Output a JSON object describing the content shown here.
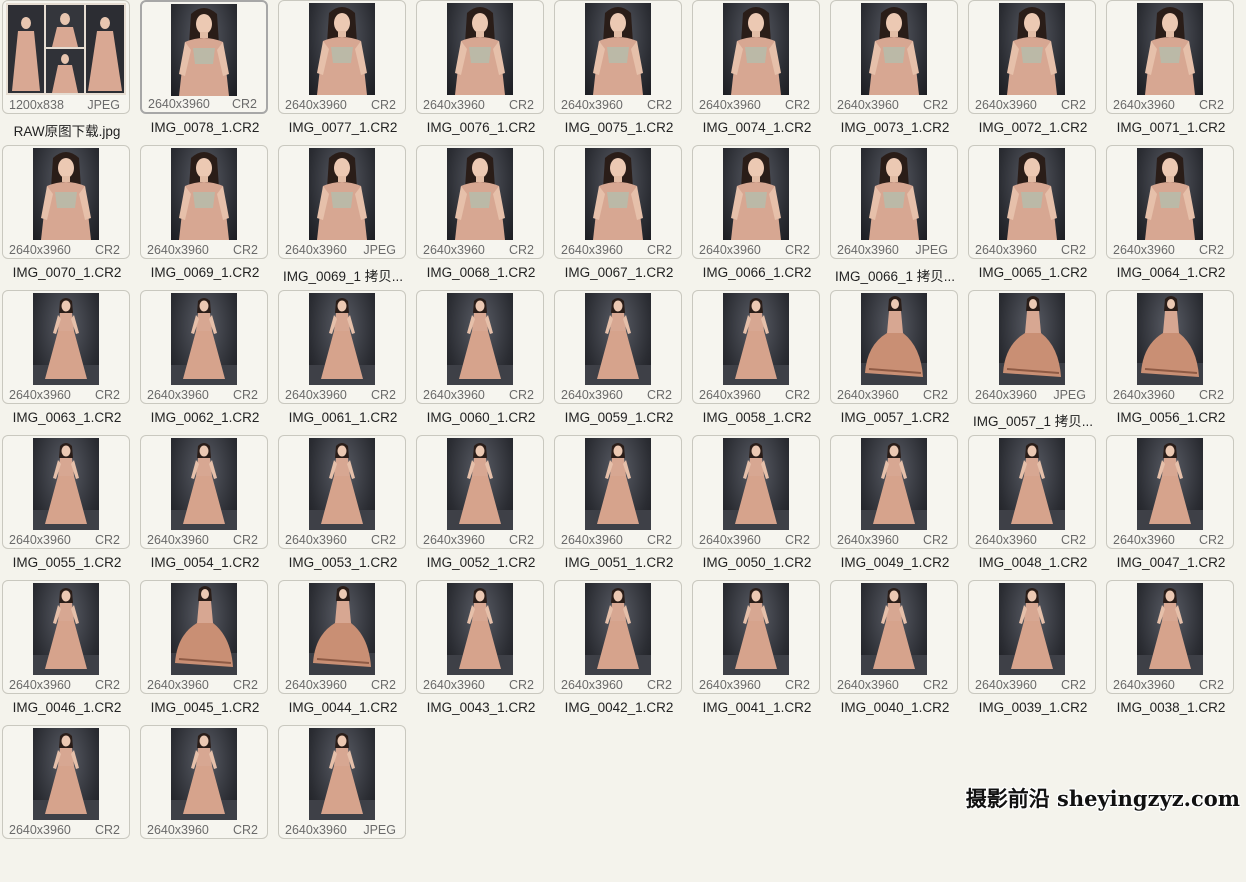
{
  "files": [
    {
      "name": "RAW原图下载.jpg",
      "dims": "1200x838",
      "type": "JPEG",
      "pose": "collage"
    },
    {
      "name": "IMG_0078_1.CR2",
      "dims": "2640x3960",
      "type": "CR2",
      "pose": "close",
      "selected": true
    },
    {
      "name": "IMG_0077_1.CR2",
      "dims": "2640x3960",
      "type": "CR2",
      "pose": "close"
    },
    {
      "name": "IMG_0076_1.CR2",
      "dims": "2640x3960",
      "type": "CR2",
      "pose": "close"
    },
    {
      "name": "IMG_0075_1.CR2",
      "dims": "2640x3960",
      "type": "CR2",
      "pose": "close"
    },
    {
      "name": "IMG_0074_1.CR2",
      "dims": "2640x3960",
      "type": "CR2",
      "pose": "close"
    },
    {
      "name": "IMG_0073_1.CR2",
      "dims": "2640x3960",
      "type": "CR2",
      "pose": "close"
    },
    {
      "name": "IMG_0072_1.CR2",
      "dims": "2640x3960",
      "type": "CR2",
      "pose": "close"
    },
    {
      "name": "IMG_0071_1.CR2",
      "dims": "2640x3960",
      "type": "CR2",
      "pose": "close"
    },
    {
      "name": "IMG_0070_1.CR2",
      "dims": "2640x3960",
      "type": "CR2",
      "pose": "close"
    },
    {
      "name": "IMG_0069_1.CR2",
      "dims": "2640x3960",
      "type": "CR2",
      "pose": "close"
    },
    {
      "name": "IMG_0069_1 拷贝...",
      "dims": "2640x3960",
      "type": "JPEG",
      "pose": "close"
    },
    {
      "name": "IMG_0068_1.CR2",
      "dims": "2640x3960",
      "type": "CR2",
      "pose": "close"
    },
    {
      "name": "IMG_0067_1.CR2",
      "dims": "2640x3960",
      "type": "CR2",
      "pose": "close"
    },
    {
      "name": "IMG_0066_1.CR2",
      "dims": "2640x3960",
      "type": "CR2",
      "pose": "close"
    },
    {
      "name": "IMG_0066_1 拷贝...",
      "dims": "2640x3960",
      "type": "JPEG",
      "pose": "close"
    },
    {
      "name": "IMG_0065_1.CR2",
      "dims": "2640x3960",
      "type": "CR2",
      "pose": "close"
    },
    {
      "name": "IMG_0064_1.CR2",
      "dims": "2640x3960",
      "type": "CR2",
      "pose": "close"
    },
    {
      "name": "IMG_0063_1.CR2",
      "dims": "2640x3960",
      "type": "CR2",
      "pose": "full"
    },
    {
      "name": "IMG_0062_1.CR2",
      "dims": "2640x3960",
      "type": "CR2",
      "pose": "full"
    },
    {
      "name": "IMG_0061_1.CR2",
      "dims": "2640x3960",
      "type": "CR2",
      "pose": "full"
    },
    {
      "name": "IMG_0060_1.CR2",
      "dims": "2640x3960",
      "type": "CR2",
      "pose": "full"
    },
    {
      "name": "IMG_0059_1.CR2",
      "dims": "2640x3960",
      "type": "CR2",
      "pose": "full"
    },
    {
      "name": "IMG_0058_1.CR2",
      "dims": "2640x3960",
      "type": "CR2",
      "pose": "full"
    },
    {
      "name": "IMG_0057_1.CR2",
      "dims": "2640x3960",
      "type": "CR2",
      "pose": "twirl"
    },
    {
      "name": "IMG_0057_1 拷贝...",
      "dims": "2640x3960",
      "type": "JPEG",
      "pose": "twirl"
    },
    {
      "name": "IMG_0056_1.CR2",
      "dims": "2640x3960",
      "type": "CR2",
      "pose": "twirl"
    },
    {
      "name": "IMG_0055_1.CR2",
      "dims": "2640x3960",
      "type": "CR2",
      "pose": "full"
    },
    {
      "name": "IMG_0054_1.CR2",
      "dims": "2640x3960",
      "type": "CR2",
      "pose": "full"
    },
    {
      "name": "IMG_0053_1.CR2",
      "dims": "2640x3960",
      "type": "CR2",
      "pose": "full"
    },
    {
      "name": "IMG_0052_1.CR2",
      "dims": "2640x3960",
      "type": "CR2",
      "pose": "full"
    },
    {
      "name": "IMG_0051_1.CR2",
      "dims": "2640x3960",
      "type": "CR2",
      "pose": "full"
    },
    {
      "name": "IMG_0050_1.CR2",
      "dims": "2640x3960",
      "type": "CR2",
      "pose": "full"
    },
    {
      "name": "IMG_0049_1.CR2",
      "dims": "2640x3960",
      "type": "CR2",
      "pose": "full"
    },
    {
      "name": "IMG_0048_1.CR2",
      "dims": "2640x3960",
      "type": "CR2",
      "pose": "full"
    },
    {
      "name": "IMG_0047_1.CR2",
      "dims": "2640x3960",
      "type": "CR2",
      "pose": "full"
    },
    {
      "name": "IMG_0046_1.CR2",
      "dims": "2640x3960",
      "type": "CR2",
      "pose": "full"
    },
    {
      "name": "IMG_0045_1.CR2",
      "dims": "2640x3960",
      "type": "CR2",
      "pose": "twirl"
    },
    {
      "name": "IMG_0044_1.CR2",
      "dims": "2640x3960",
      "type": "CR2",
      "pose": "twirl"
    },
    {
      "name": "IMG_0043_1.CR2",
      "dims": "2640x3960",
      "type": "CR2",
      "pose": "full"
    },
    {
      "name": "IMG_0042_1.CR2",
      "dims": "2640x3960",
      "type": "CR2",
      "pose": "full"
    },
    {
      "name": "IMG_0041_1.CR2",
      "dims": "2640x3960",
      "type": "CR2",
      "pose": "full"
    },
    {
      "name": "IMG_0040_1.CR2",
      "dims": "2640x3960",
      "type": "CR2",
      "pose": "full"
    },
    {
      "name": "IMG_0039_1.CR2",
      "dims": "2640x3960",
      "type": "CR2",
      "pose": "full"
    },
    {
      "name": "IMG_0038_1.CR2",
      "dims": "2640x3960",
      "type": "CR2",
      "pose": "full"
    },
    {
      "name": "",
      "dims": "2640x3960",
      "type": "CR2",
      "pose": "full"
    },
    {
      "name": "",
      "dims": "2640x3960",
      "type": "CR2",
      "pose": "full"
    },
    {
      "name": "",
      "dims": "2640x3960",
      "type": "JPEG",
      "pose": "full"
    }
  ],
  "watermark": "摄影前沿 sheyingzyz.com",
  "colors": {
    "background": "#f4f3ec",
    "thumb_backdrop": "#2b2d33",
    "dress": "#d9a893",
    "selected_border": "#a7a7a7"
  }
}
